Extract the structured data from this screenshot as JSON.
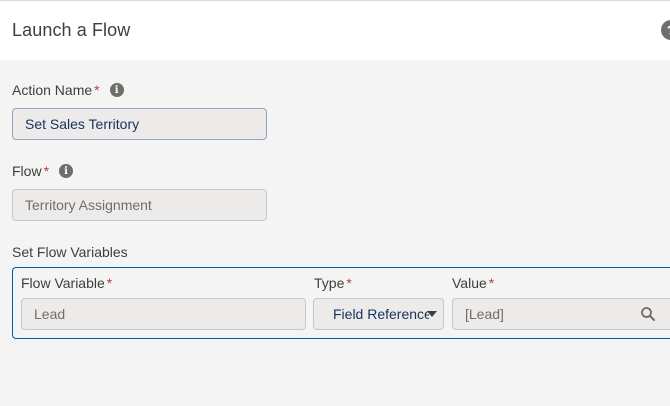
{
  "header": {
    "title": "Launch a Flow",
    "help_icon": "?"
  },
  "action_name": {
    "label": "Action Name",
    "required": "*",
    "value": "Set Sales Territory",
    "info_icon": "i"
  },
  "flow": {
    "label": "Flow",
    "required": "*",
    "value": "Territory Assignment",
    "info_icon": "i"
  },
  "flow_variables": {
    "section_label": "Set Flow Variables",
    "columns": {
      "variable": {
        "label": "Flow Variable",
        "required": "*"
      },
      "type": {
        "label": "Type",
        "required": "*"
      },
      "value": {
        "label": "Value",
        "required": "*"
      }
    },
    "row": {
      "variable": "Lead",
      "type": "Field Reference",
      "value": "[Lead]"
    }
  },
  "colors": {
    "accent": "#0b5aa5",
    "required": "#c23934",
    "field_bg": "#ecebea"
  }
}
